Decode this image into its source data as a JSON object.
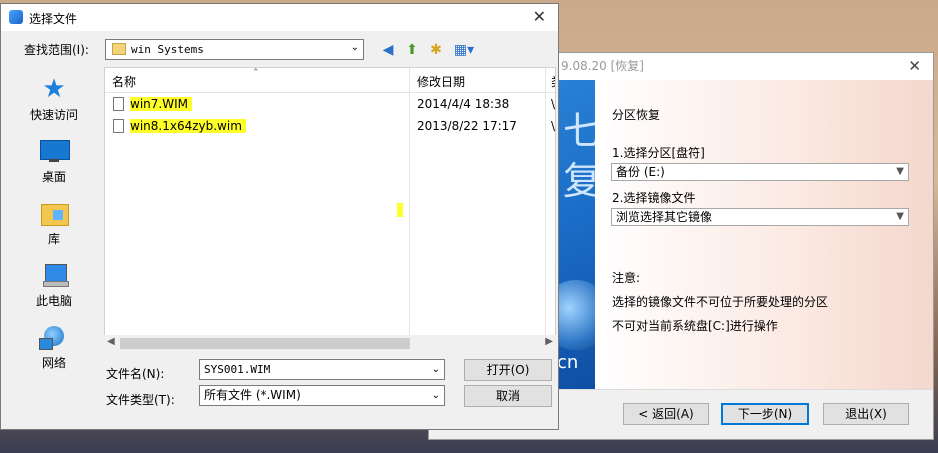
{
  "restore_window": {
    "title": "9.08.20 [恢复]",
    "close": "✕",
    "side_chars": [
      "七",
      "复"
    ],
    "side_text": "cn",
    "header": "分区恢复",
    "step1_label": "1.选择分区[盘符]",
    "step1_value": "备份 (E:)",
    "step2_label": "2.选择镜像文件",
    "step2_value": "浏览选择其它镜像",
    "note_title": "注意:",
    "note_line1": "选择的镜像文件不可位于所要处理的分区",
    "note_line2": "不可对当前系统盘[C:]进行操作",
    "back_button": "< 返回(A)",
    "next_button": "下一步(N)",
    "exit_button": "退出(X)"
  },
  "dialog": {
    "title": "选择文件",
    "close": "✕",
    "look_in_label": "查找范围(I):",
    "look_in_value": "win Systems",
    "places": [
      {
        "label": "快速访问",
        "icon": "star-icon"
      },
      {
        "label": "桌面",
        "icon": "desktop-icon"
      },
      {
        "label": "库",
        "icon": "library-icon"
      },
      {
        "label": "此电脑",
        "icon": "computer-icon"
      },
      {
        "label": "网络",
        "icon": "network-icon"
      }
    ],
    "columns": {
      "name": "名称",
      "date": "修改日期",
      "more": "类"
    },
    "files": [
      {
        "name": "win7.WIM",
        "date": "2014/4/4 18:38",
        "more": "\\"
      },
      {
        "name": "win8.1x64zyb.wim",
        "date": "2013/8/22 17:17",
        "more": "\\"
      }
    ],
    "filename_label": "文件名(N):",
    "filename_value": "SYS001.WIM",
    "filetype_label": "文件类型(T):",
    "filetype_value": "所有文件 (*.WIM)",
    "open_button": "打开(O)",
    "cancel_button": "取消"
  },
  "colors": {
    "highlight": "#ffff29",
    "accent": "#0078d7"
  }
}
